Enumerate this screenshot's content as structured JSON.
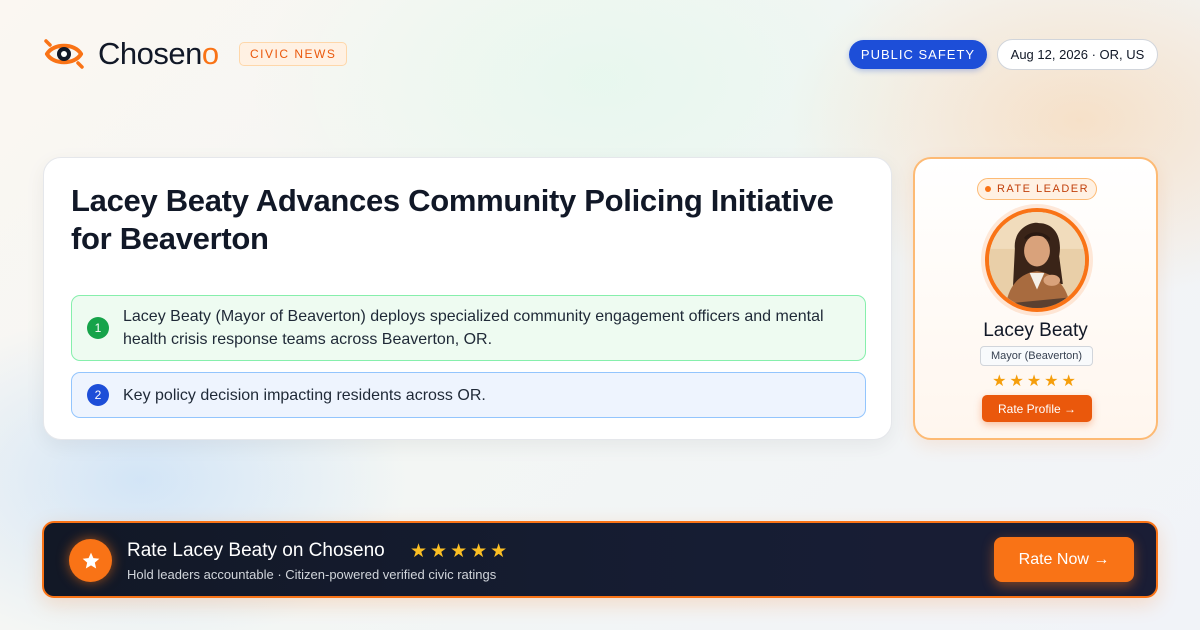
{
  "brand": {
    "name_main": "Chosen",
    "name_accent": "o",
    "tag": "CIVIC NEWS"
  },
  "header": {
    "category": "PUBLIC SAFETY",
    "date_location": "Aug 12, 2026 · OR, US"
  },
  "article": {
    "headline": "Lacey Beaty Advances Community Policing Initiative for Beaverton",
    "points": [
      {
        "number": "1",
        "text": "Lacey Beaty (Mayor of Beaverton) deploys specialized community engagement officers and mental health crisis response teams across Beaverton, OR."
      },
      {
        "number": "2",
        "text": "Key policy decision impacting residents across OR."
      }
    ]
  },
  "leader_card": {
    "tag": "RATE LEADER",
    "name": "Lacey Beaty",
    "role": "Mayor (Beaverton)",
    "stars": "★★★★★",
    "button_label": "Rate Profile →"
  },
  "banner": {
    "title": "Rate Lacey Beaty on Choseno",
    "stars": "★★★★★",
    "subtitle": "Hold leaders accountable · Citizen-powered verified civic ratings",
    "button_label": "Rate Now →"
  },
  "icons": {
    "logo": "eye-logo-icon",
    "banner": "star-icon",
    "tag_dot": "dot-icon"
  },
  "colors": {
    "accent": "#f97316",
    "category_blue": "#1d4ed8",
    "point_green": "#16a34a",
    "banner_bg": "#121826"
  }
}
